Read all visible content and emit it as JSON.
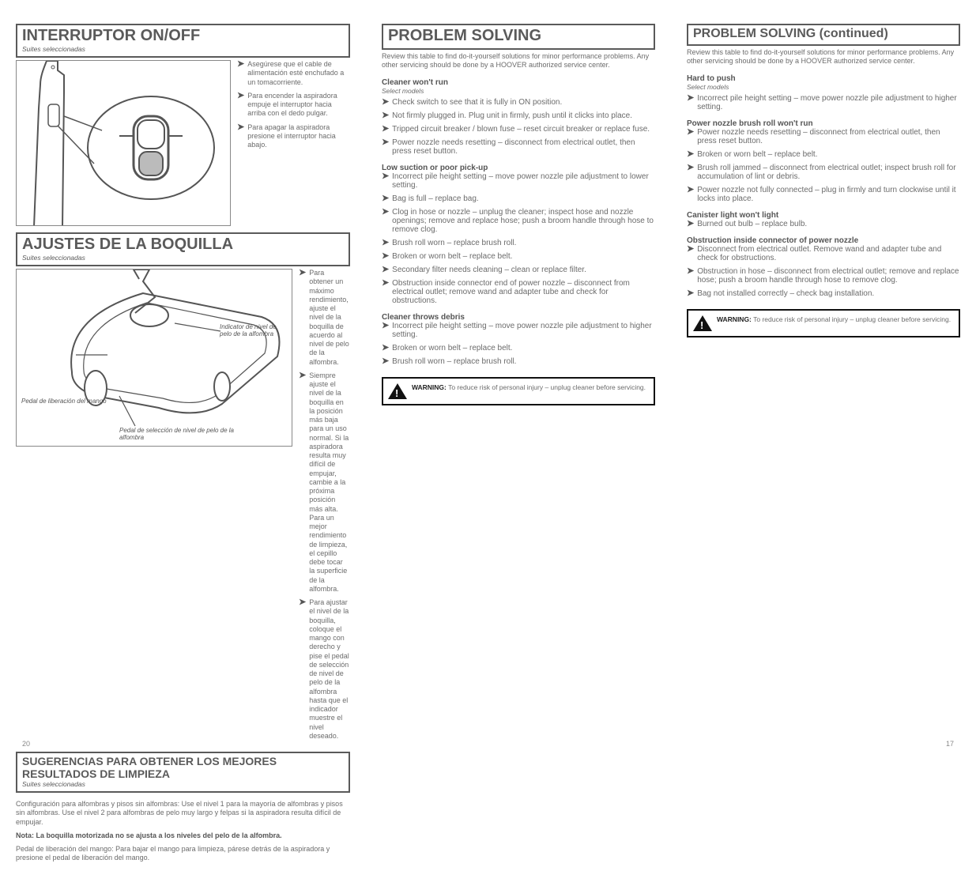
{
  "left": {
    "switch": {
      "title": "INTERRUPTOR ON/OFF",
      "subtitle": "Suites seleccionadas",
      "bullets": [
        "Asegúrese que el cable de alimentación esté enchufado a un tomacorriente.",
        "Para encender la aspiradora empuje el interruptor hacia arriba con el dedo pulgar.",
        "Para apagar la aspiradora presione el interruptor hacia abajo."
      ]
    },
    "nozzle": {
      "title": "AJUSTES DE LA BOQUILLA",
      "subtitle": "Suites seleccionadas",
      "callouts": {
        "indicator": "Indicator de nivel de pelo de la alfombra",
        "releasePedal": "Pedal de liberación del mango",
        "selectPedal": "Pedal de selección de nivel de pelo de la alfombra"
      },
      "bullets": [
        "Para obtener un máximo rendimiento, ajuste el nivel de la boquilla de acuerdo al nivel de pelo de la alfombra.",
        "Siempre ajuste el nivel de la boquilla en la posición más baja para un uso normal. Si la aspiradora resulta muy difícil de empujar, cambie a la próxima posición más alta. Para un mejor rendimiento de limpieza, el cepillo debe tocar la superficie de la alfombra.",
        "Para ajustar el nivel de la boquilla, coloque el mango con derecho y pise el pedal de selección de nivel de pelo de la alfombra hasta que el indicador muestre el nivel deseado."
      ]
    },
    "suggest": {
      "title": "SUGERENCIAS PARA OBTENER LOS MEJORES RESULTADOS DE LIMPIEZA",
      "subtitle": "Suites seleccionadas",
      "paragraphs": [
        "Configuración para alfombras y pisos sin alfombras: Use el nivel 1 para la mayoría de alfombras y pisos sin alfombras. Use el nivel 2 para alfombras de pelo muy largo y felpas si la aspiradora resulta difícil de empujar.",
        "Nota: La boquilla motorizada no se ajusta a los niveles del pelo de la alfombra.",
        "Pedal de liberación del mango: Para bajar el mango para limpieza, párese detrás de la aspiradora y presione el pedal de liberación del mango."
      ]
    }
  },
  "mid": {
    "header": {
      "title": "PROBLEM SOLVING"
    },
    "intro": "Review this table to find do-it-yourself solutions for minor performance problems. Any other servicing should be done by a HOOVER authorized service center.",
    "groups": [
      {
        "heading": "Cleaner won't run",
        "sub": "Select models",
        "items": [
          "Check switch to see that it is fully in ON position.",
          "Not firmly plugged in. Plug unit in firmly, push until it clicks into place.",
          "Tripped circuit breaker / blown fuse – reset circuit breaker or replace fuse.",
          "Power nozzle needs resetting – disconnect from electrical outlet, then press reset button."
        ]
      },
      {
        "heading": "Low suction or poor pick-up",
        "items": [
          "Incorrect pile height setting – move power nozzle pile adjustment to lower setting.",
          "Bag is full – replace bag.",
          "Clog in hose or nozzle – unplug the cleaner; inspect hose and nozzle openings; remove and replace hose; push a broom handle through hose to remove clog.",
          "Brush roll worn – replace brush roll.",
          "Broken or worn belt – replace belt.",
          "Secondary filter needs cleaning – clean or replace filter.",
          "Obstruction inside connector end of power nozzle – disconnect from electrical outlet; remove wand and adapter tube and check for obstructions."
        ]
      },
      {
        "heading": "Cleaner throws debris",
        "items": [
          "Incorrect pile height setting – move power nozzle pile adjustment to higher setting.",
          "Broken or worn belt – replace belt.",
          "Brush roll worn – replace brush roll."
        ]
      }
    ],
    "warning": {
      "lead": "WARNING:",
      "text": "To reduce risk of personal injury – unplug cleaner before servicing."
    }
  },
  "right": {
    "header": {
      "title": "PROBLEM SOLVING (continued)"
    },
    "intro": "Review this table to find do-it-yourself solutions for minor performance problems. Any other servicing should be done by a HOOVER authorized service center.",
    "groups": [
      {
        "heading": "Hard to push",
        "sub": "Select models",
        "items": [
          "Incorrect pile height setting – move power nozzle pile adjustment to higher setting."
        ]
      },
      {
        "heading": "Power nozzle brush roll won't run",
        "items": [
          "Power nozzle needs resetting – disconnect from electrical outlet, then press reset button.",
          "Broken or worn belt – replace belt.",
          "Brush roll jammed – disconnect from electrical outlet; inspect brush roll for accumulation of lint or debris.",
          "Power nozzle not fully connected – plug in firmly and turn clockwise until it locks into place."
        ]
      },
      {
        "heading": "Canister light won't light",
        "items": [
          "Burned out bulb – replace bulb."
        ]
      },
      {
        "heading": "Obstruction inside connector of power nozzle",
        "items": [
          "Disconnect from electrical outlet. Remove wand and adapter tube and check for obstructions.",
          "Obstruction in hose – disconnect from electrical outlet; remove and replace hose; push a broom handle through hose to remove clog.",
          "Bag not installed correctly – check bag installation."
        ]
      }
    ],
    "warning": {
      "lead": "WARNING:",
      "text": "To reduce risk of personal injury – unplug cleaner before servicing."
    }
  },
  "pageLeft": "20",
  "pageRight": "17"
}
